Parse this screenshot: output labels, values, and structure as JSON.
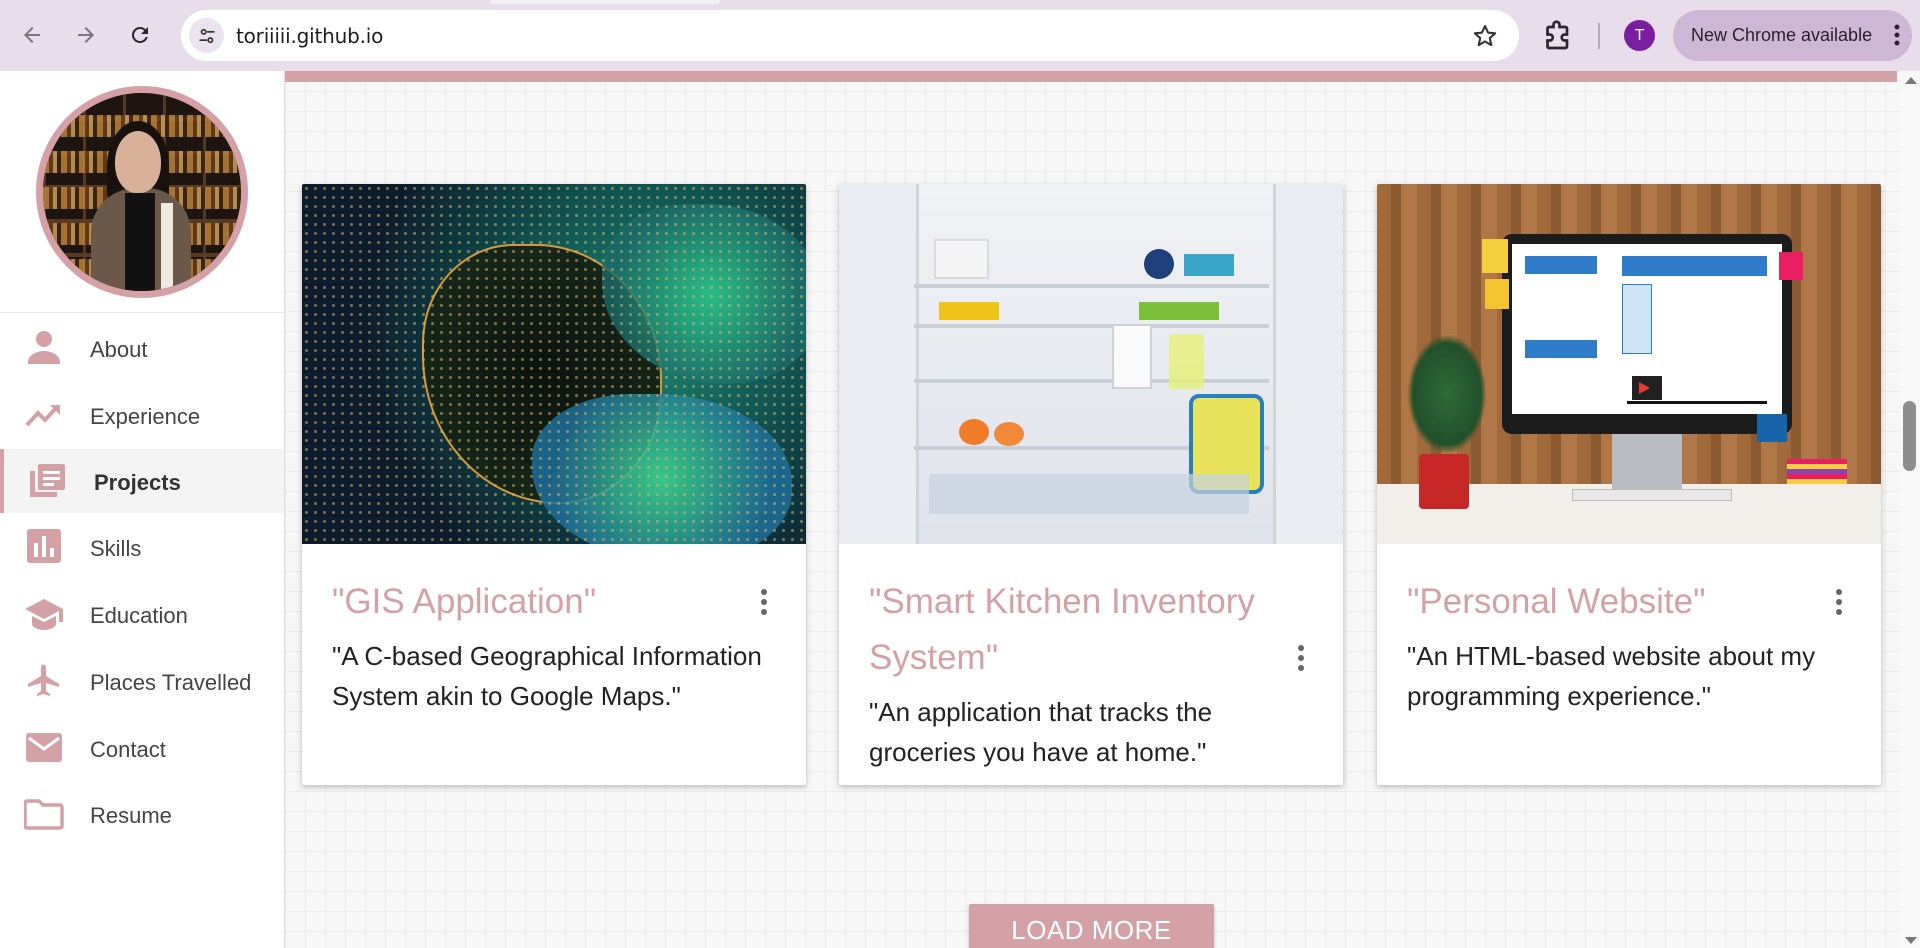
{
  "browser": {
    "url": "toriiiii.github.io",
    "profile_initial": "T",
    "update_label": "New Chrome available"
  },
  "sidebar": {
    "items": [
      {
        "label": "About",
        "icon": "person-icon",
        "active": false
      },
      {
        "label": "Experience",
        "icon": "trending-up-icon",
        "active": false
      },
      {
        "label": "Projects",
        "icon": "library-books-icon",
        "active": true
      },
      {
        "label": "Skills",
        "icon": "bar-chart-icon",
        "active": false
      },
      {
        "label": "Education",
        "icon": "graduation-cap-icon",
        "active": false
      },
      {
        "label": "Places Travelled",
        "icon": "airplane-icon",
        "active": false
      },
      {
        "label": "Contact",
        "icon": "mail-icon",
        "active": false
      },
      {
        "label": "Resume",
        "icon": "folder-icon",
        "active": false
      }
    ]
  },
  "projects": [
    {
      "title": "\"GIS Application\"",
      "description": "\"A C-based Geographical Information System akin to Google Maps.\"",
      "image": "glowing-world-map"
    },
    {
      "title": "\"Smart Kitchen Inventory System\"",
      "description": "\"An application that tracks the groceries you have at home.\"",
      "image": "open-refrigerator"
    },
    {
      "title": "\"Personal Website\"",
      "description": "\"An HTML-based website about my programming experience.\"",
      "image": "website-monitor-desk"
    }
  ],
  "load_more_label": "LOAD MORE",
  "colors": {
    "accent": "#d4a1a7",
    "chrome": "#e8ddeb",
    "profile": "#7b1fa2"
  }
}
